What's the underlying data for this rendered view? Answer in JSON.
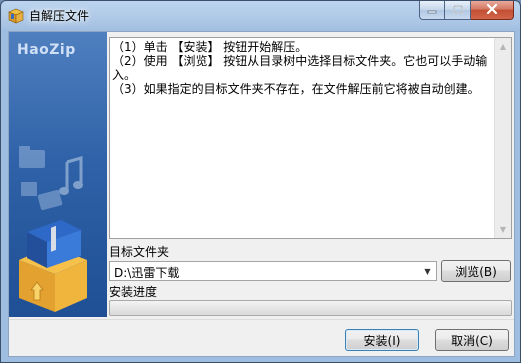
{
  "window": {
    "title": "自解压文件",
    "controls": {
      "minimize_icon": "minimize-icon",
      "maximize_icon": "maximize-icon",
      "close_icon": "close-icon"
    }
  },
  "side_panel": {
    "brand": "HaoZip",
    "icons": [
      "folder-icon",
      "video-icon",
      "music-note-icon",
      "image-icon",
      "archive-box-icon"
    ]
  },
  "instructions": {
    "text": "（1）单击 【安装】 按钮开始解压。\n（2）使用 【浏览】 按钮从目录树中选择目标文件夹。它也可以手动输入。\n（3）如果指定的目标文件夹不存在，在文件解压前它将被自动创建。"
  },
  "target": {
    "label": "目标文件夹",
    "path_value": "D:\\迅雷下载",
    "browse_label": "浏览(B)"
  },
  "progress": {
    "label": "安装进度",
    "value_percent": 0
  },
  "buttons": {
    "install_label": "安装(I)",
    "cancel_label": "取消(C)"
  },
  "colors": {
    "title_bar": "#a9c4e4",
    "side_panel": "#2f62a8",
    "progress_fill": "#3fbf3f"
  }
}
